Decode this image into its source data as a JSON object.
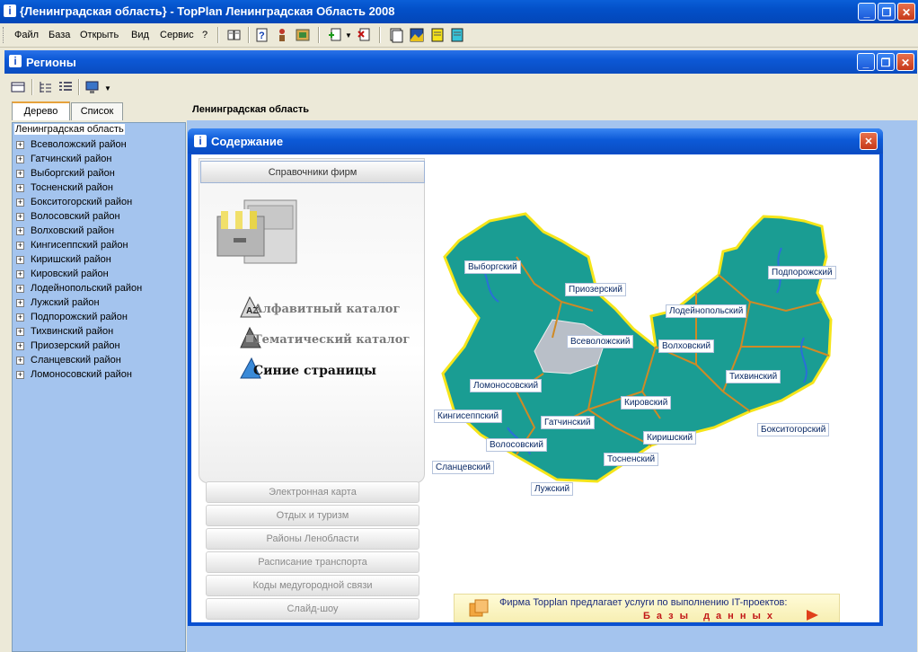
{
  "app": {
    "title": "{Ленинградская область} - TopPlan Ленинградская Область 2008",
    "min": "_",
    "restore": "❐",
    "close": "✕"
  },
  "menu": [
    "Файл",
    "База",
    "Открыть",
    "Вид",
    "Сервис",
    "?"
  ],
  "child": {
    "title": "Регионы",
    "tabs": [
      "Дерево",
      "Список"
    ],
    "header": "Ленинградская область"
  },
  "tree": {
    "root": "Ленинградская область",
    "items": [
      "Всеволожский район",
      "Гатчинский район",
      "Выборгский район",
      "Тосненский район",
      "Бокситогорский район",
      "Волосовский район",
      "Волховский район",
      "Кингисеппский район",
      "Киришский район",
      "Кировский район",
      "Лодейнопольский район",
      "Лужский район",
      "Подпорожский район",
      "Тихвинский район",
      "Приозерский район",
      "Сланцевский район",
      "Ломоносовский район"
    ]
  },
  "dialog": {
    "title": "Содержание",
    "active_section": "Справочники фирм",
    "catalogs": [
      "Алфавитный каталог",
      "Тематический каталог",
      "Синие страницы"
    ],
    "sections": [
      "Электронная карта",
      "Отдых и туризм",
      "Районы Ленобласти",
      "Расписание транспорта",
      "Коды медугородной связи",
      "Слайд-шоу"
    ],
    "banner_line1": "Фирма Topplan предлагает услуги по выполнению IT-проектов:",
    "banner_line2": "Базы данных"
  },
  "map": {
    "labels": [
      "Выборгский",
      "Приозерский",
      "Подпорожский",
      "Лодейнопольский",
      "Всеволожский",
      "Волховский",
      "Тихвинский",
      "Ломоносовский",
      "Кировский",
      "Кингисеппский",
      "Гатчинский",
      "Киришский",
      "Бокситогорский",
      "Волосовский",
      "Тосненский",
      "Сланцевский",
      "Лужский"
    ]
  },
  "colors": {
    "map_fill": "#1a9d93",
    "map_border": "#f5e51a",
    "map_districts": "#d08a25",
    "tree_bg": "#a4c4ee",
    "titlebar": "#0350c8"
  }
}
